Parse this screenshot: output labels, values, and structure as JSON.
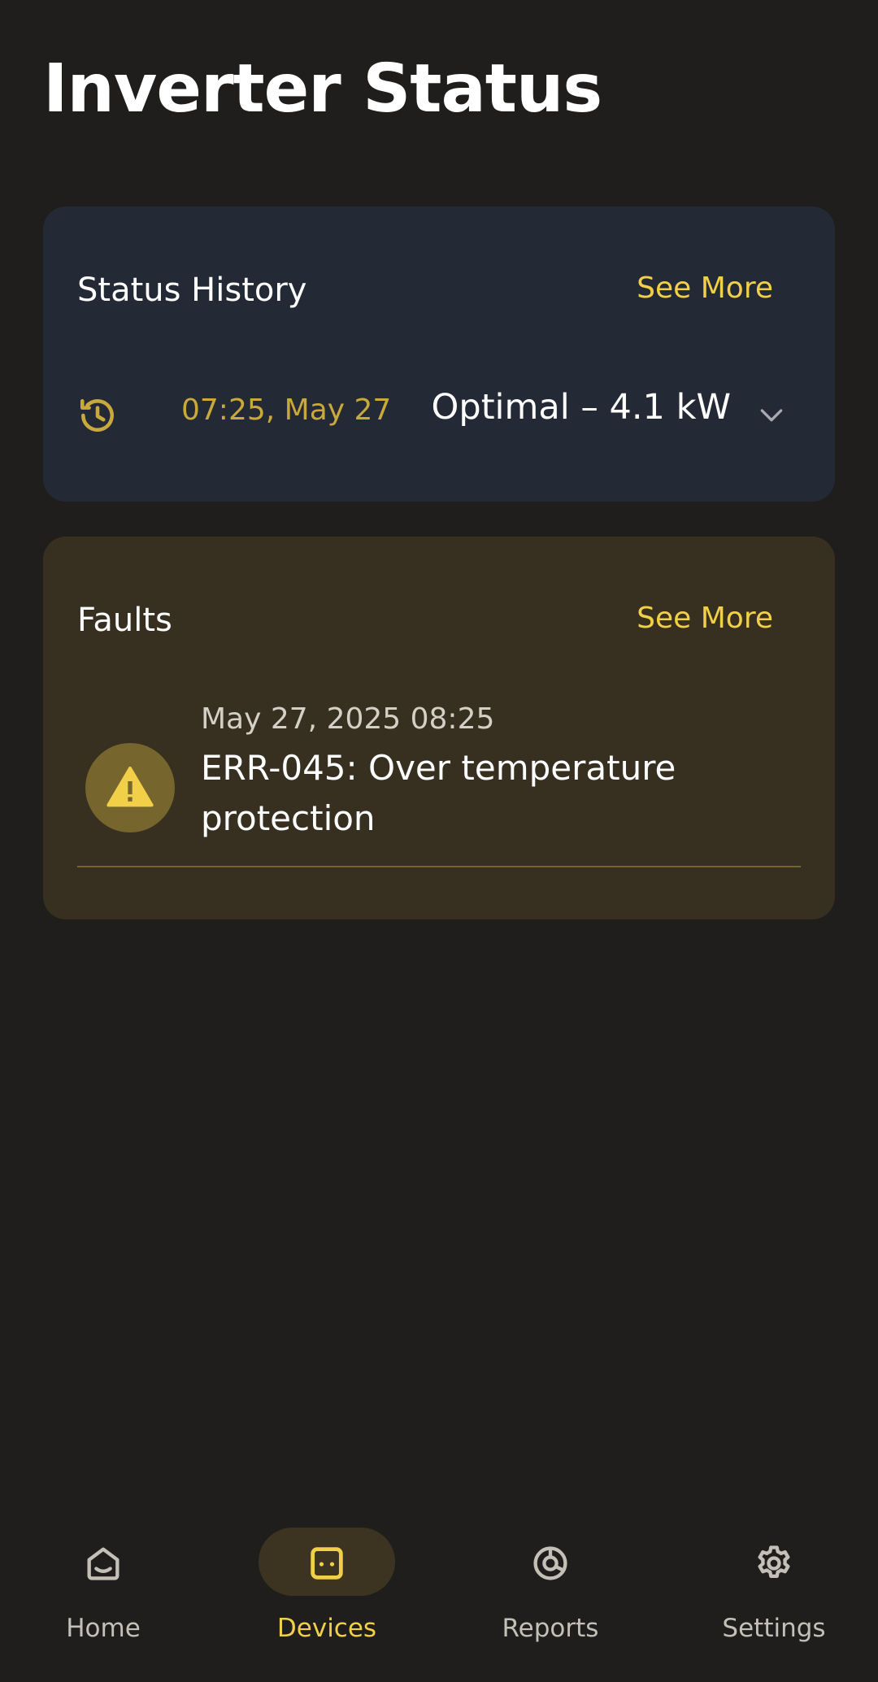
{
  "page": {
    "title": "Inverter Status"
  },
  "status_history": {
    "title": "Status History",
    "see_more": "See More",
    "entry": {
      "time": "07:25, May 27",
      "status": "Optimal – 4.1 kW"
    }
  },
  "faults": {
    "title": "Faults",
    "see_more": "See More",
    "items": [
      {
        "date": "May 27, 2025 08:25",
        "message": "ERR-045: Over temperature protection"
      }
    ]
  },
  "nav": {
    "items": [
      {
        "label": "Home",
        "icon": "home-icon"
      },
      {
        "label": "Devices",
        "icon": "devices-icon",
        "active": true
      },
      {
        "label": "Reports",
        "icon": "reports-icon"
      },
      {
        "label": "Settings",
        "icon": "gear-icon"
      }
    ]
  },
  "colors": {
    "accent": "#f2cf48",
    "background": "#1f1e1d",
    "history_card": "#232935",
    "faults_card": "#373020"
  }
}
